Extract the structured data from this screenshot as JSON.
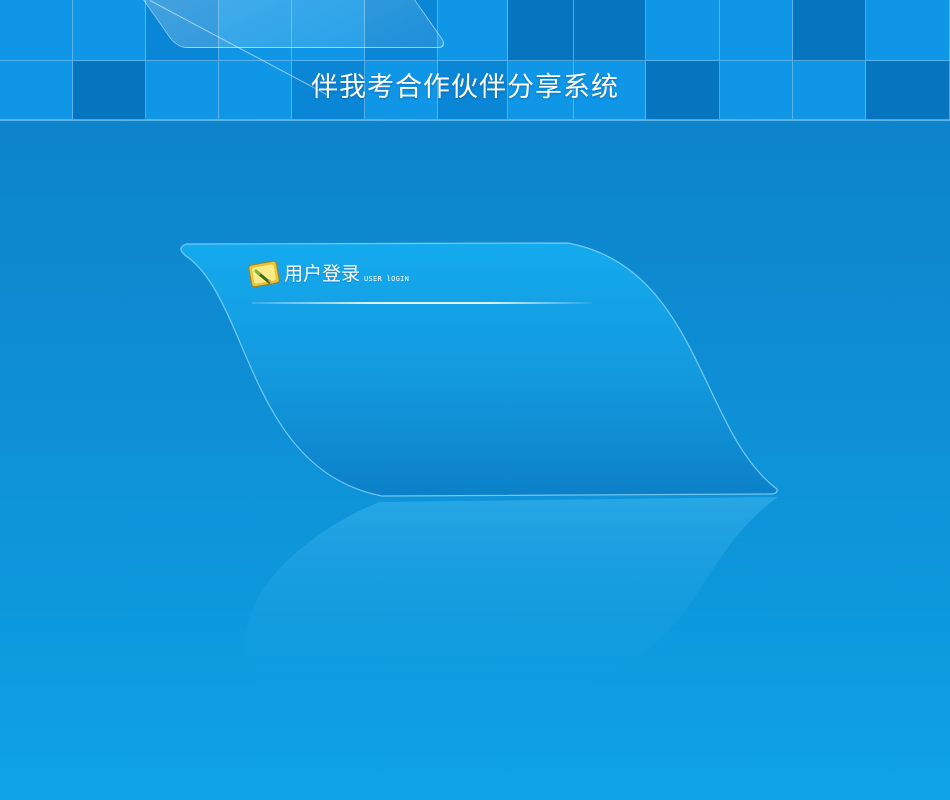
{
  "header": {
    "title": "伴我考合作伙伴分享系统"
  },
  "login": {
    "title": "用户登录",
    "subtitle": "USER lOGIN",
    "icon": "login-pen-icon"
  },
  "colors": {
    "background": "#0d8fd6",
    "header_tile_light": "#0f96e6",
    "header_tile_dark": "#0675bf",
    "panel": "#1aa8eb",
    "text": "#ffffff"
  }
}
